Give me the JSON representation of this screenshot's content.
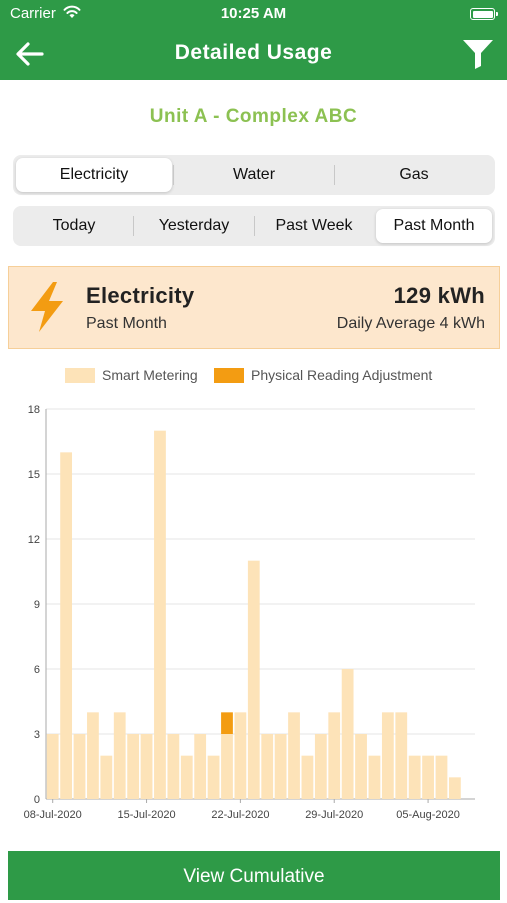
{
  "status_bar": {
    "carrier": "Carrier",
    "time": "10:25 AM"
  },
  "nav": {
    "title": "Detailed Usage",
    "back_icon": "arrow-left-icon",
    "filter_icon": "filter-icon"
  },
  "unit_title": "Unit A - Complex ABC",
  "utility_tabs": [
    {
      "label": "Electricity",
      "active": true
    },
    {
      "label": "Water",
      "active": false
    },
    {
      "label": "Gas",
      "active": false
    }
  ],
  "period_tabs": [
    {
      "label": "Today",
      "active": false
    },
    {
      "label": "Yesterday",
      "active": false
    },
    {
      "label": "Past Week",
      "active": false
    },
    {
      "label": "Past Month",
      "active": true
    }
  ],
  "summary": {
    "utility": "Electricity",
    "period": "Past Month",
    "total": "129 kWh",
    "daily_average": "Daily Average 4 kWh",
    "icon": "lightning-bolt-icon"
  },
  "colors": {
    "brand_green": "#2e9a47",
    "title_green": "#8cc152",
    "smart": "#fde3b8",
    "physical": "#f39c12",
    "bolt": "#f39c12"
  },
  "chart_data": {
    "type": "bar",
    "stacked": true,
    "x_tick_labels": [
      "08-Jul-2020",
      "15-Jul-2020",
      "22-Jul-2020",
      "29-Jul-2020",
      "05-Aug-2020"
    ],
    "x_tick_indices": [
      0,
      7,
      14,
      21,
      28
    ],
    "categories": [
      "08-Jul-2020",
      "09-Jul-2020",
      "10-Jul-2020",
      "11-Jul-2020",
      "12-Jul-2020",
      "13-Jul-2020",
      "14-Jul-2020",
      "15-Jul-2020",
      "16-Jul-2020",
      "17-Jul-2020",
      "18-Jul-2020",
      "19-Jul-2020",
      "20-Jul-2020",
      "21-Jul-2020",
      "22-Jul-2020",
      "23-Jul-2020",
      "24-Jul-2020",
      "25-Jul-2020",
      "26-Jul-2020",
      "27-Jul-2020",
      "28-Jul-2020",
      "29-Jul-2020",
      "30-Jul-2020",
      "31-Jul-2020",
      "01-Aug-2020",
      "02-Aug-2020",
      "03-Aug-2020",
      "04-Aug-2020",
      "05-Aug-2020",
      "06-Aug-2020",
      "07-Aug-2020",
      "08-Aug-2020"
    ],
    "series": [
      {
        "name": "Smart Metering",
        "color": "#fde3b8",
        "values": [
          3,
          16,
          3,
          4,
          2,
          4,
          3,
          3,
          17,
          3,
          2,
          3,
          2,
          3,
          4,
          11,
          3,
          3,
          4,
          2,
          3,
          4,
          6,
          3,
          2,
          4,
          4,
          2,
          2,
          2,
          1,
          0
        ]
      },
      {
        "name": "Physical Reading Adjustment",
        "color": "#f39c12",
        "values": [
          0,
          0,
          0,
          0,
          0,
          0,
          0,
          0,
          0,
          0,
          0,
          0,
          0,
          1,
          0,
          0,
          0,
          0,
          0,
          0,
          0,
          0,
          0,
          0,
          0,
          0,
          0,
          0,
          0,
          0,
          0,
          0
        ]
      }
    ],
    "yticks": [
      0,
      3,
      6,
      9,
      12,
      15,
      18
    ],
    "ylim": [
      0,
      18
    ],
    "grid": true,
    "legend_position": "top"
  },
  "footer": {
    "button_label": "View Cumulative"
  }
}
